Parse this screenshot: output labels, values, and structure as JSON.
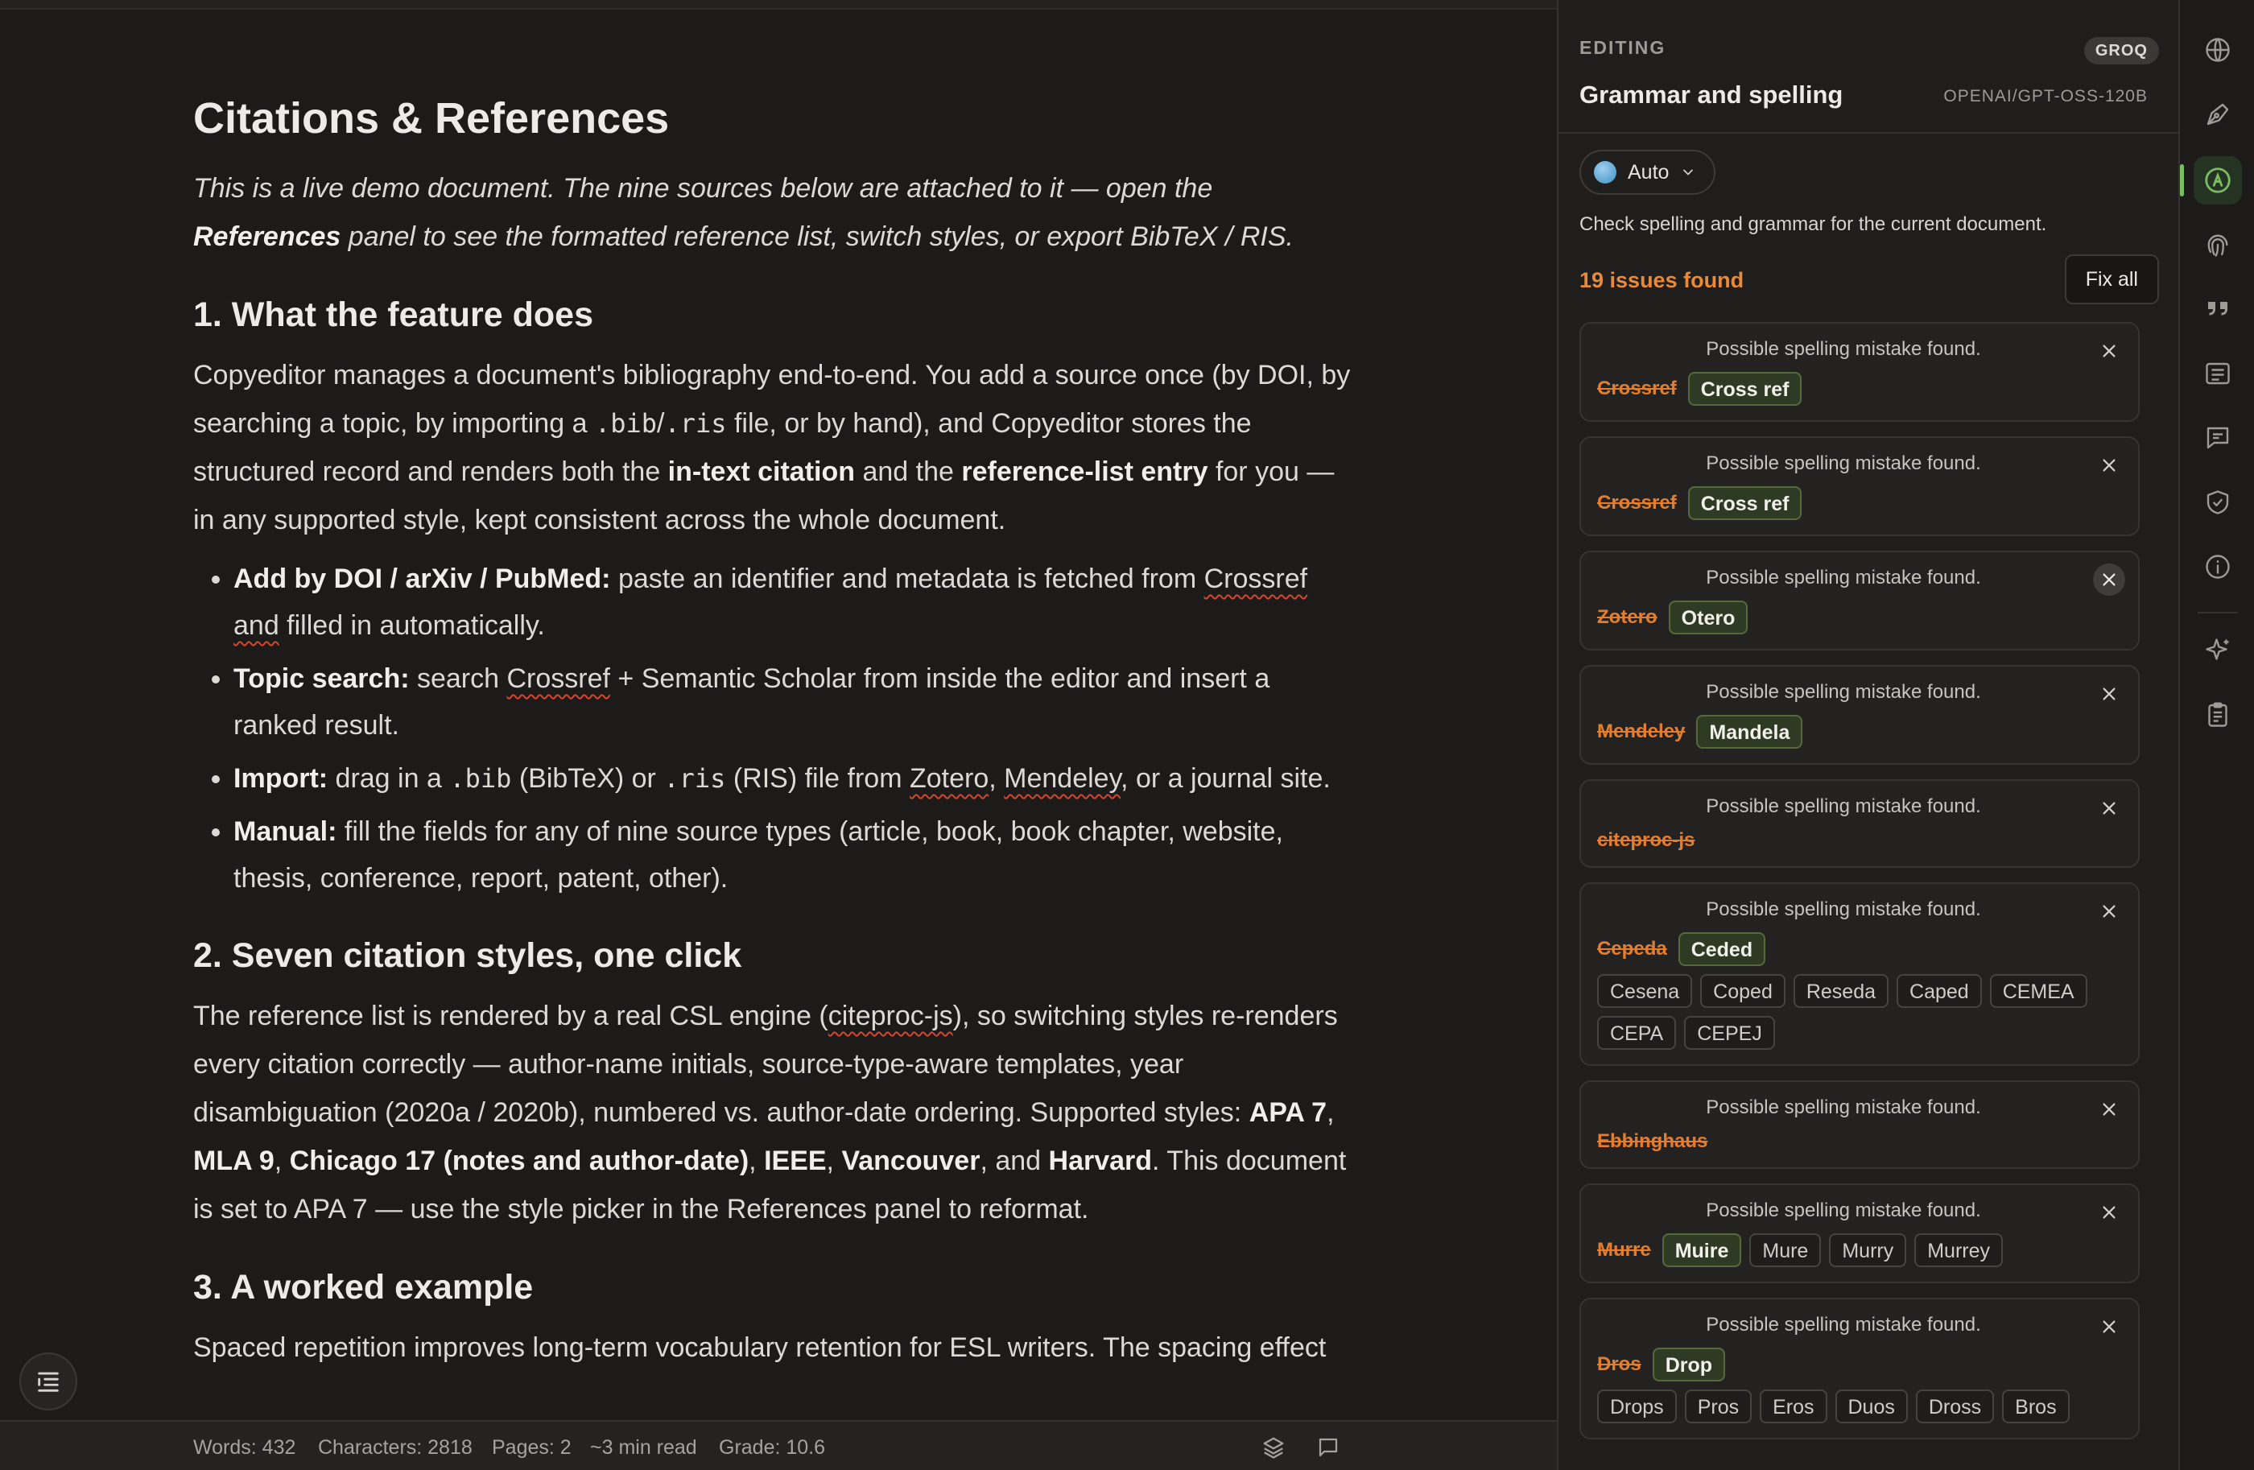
{
  "document": {
    "title": "Citations & References",
    "intro": {
      "a": "This is a live demo document. The nine sources below are attached to it — open the ",
      "b": "References",
      "c": " panel to see the formatted reference list, switch styles, or export BibTeX / RIS."
    },
    "s1": {
      "heading": "1. What the feature does",
      "p1": "Copyeditor manages a document's bibliography end-to-end. You add a source once (by DOI, by searching a topic, by importing a ",
      "code1": ".bib",
      "slash": "/",
      "code2": ".ris",
      "p2": " file, or by hand), and Copyeditor stores the structured record and renders both the ",
      "b1": "in-text citation",
      "p3": " and the ",
      "b2": "reference-list entry",
      "p4": " for you — in any supported style, kept consistent across the whole document.",
      "bullets": {
        "b1_label": "Add by DOI / arXiv / PubMed:",
        "b1_text": " paste an identifier and metadata is fetched from ",
        "b1_sq": "Crossref",
        "b1_sq2": "and",
        "b1_end": " filled in automatically.",
        "b2_label": "Topic search:",
        "b2_text": " search ",
        "b2_sq": "Crossref",
        "b2_end": " + Semantic Scholar from inside the editor and insert a ranked result.",
        "b3_label": "Import:",
        "b3_t1": " drag in a ",
        "b3_c1": ".bib",
        "b3_t2": " (BibTeX) or ",
        "b3_c2": ".ris",
        "b3_t3": " (RIS) file from ",
        "b3_sq1": "Zotero",
        "b3_t4": ", ",
        "b3_sq2": "Mendeley",
        "b3_end": ", or a journal site.",
        "b4_label": "Manual:",
        "b4_text": " fill the fields for any of nine source types (article, book, book chapter, website, thesis, conference, report, patent, other)."
      }
    },
    "s2": {
      "heading": "2. Seven citation styles, one click",
      "t1": "The reference list is rendered by a real CSL engine (",
      "sq": "citeproc-js",
      "t2": "), so switching styles re-renders every citation correctly — author-name initials, source-type-aware templates, year disambiguation (2020a / 2020b), numbered vs. author-date ordering. Supported styles: ",
      "st1": "APA 7",
      "c1": ", ",
      "st2": "MLA 9",
      "c2": ", ",
      "st3": "Chicago 17 (notes and author-date)",
      "c3": ", ",
      "st4": "IEEE",
      "c4": ", ",
      "st5": "Vancouver",
      "c5": ", and ",
      "st6": "Harvard",
      "t3": ". This document is set to APA 7 — use the style picker in the References panel to reformat."
    },
    "s3": {
      "heading": "3. A worked example",
      "p": "Spaced repetition improves long-term vocabulary retention for ESL writers. The spacing effect"
    }
  },
  "statusbar": {
    "words": "Words: 432",
    "characters": "Characters: 2818",
    "pages": "Pages: 2",
    "read": "~3 min read",
    "grade": "Grade: 10.6"
  },
  "panel": {
    "section": "EDITING",
    "provider": "GROQ",
    "title": "Grammar and spelling",
    "model": "OPENAI/GPT-OSS-120B",
    "language": "Auto",
    "description": "Check spelling and grammar for the current document.",
    "issue_count": "19 issues found",
    "fix_all": "Fix all",
    "issues": [
      {
        "message": "Possible spelling mistake found.",
        "wrong": "Crossref",
        "primary": "Cross ref",
        "alternatives": []
      },
      {
        "message": "Possible spelling mistake found.",
        "wrong": "Crossref",
        "primary": "Cross ref",
        "alternatives": []
      },
      {
        "message": "Possible spelling mistake found.",
        "wrong": "Zotero",
        "primary": "Otero",
        "alternatives": []
      },
      {
        "message": "Possible spelling mistake found.",
        "wrong": "Mendeley",
        "primary": "Mandela",
        "alternatives": []
      },
      {
        "message": "Possible spelling mistake found.",
        "wrong": "citeproc-js",
        "primary": "",
        "alternatives": []
      },
      {
        "message": "Possible spelling mistake found.",
        "wrong": "Cepeda",
        "primary": "Ceded",
        "alternatives": [
          "Cesena",
          "Coped",
          "Reseda",
          "Caped",
          "CEMEA",
          "CEPA",
          "CEPEJ"
        ]
      },
      {
        "message": "Possible spelling mistake found.",
        "wrong": "Ebbinghaus",
        "primary": "",
        "alternatives": []
      },
      {
        "message": "Possible spelling mistake found.",
        "wrong": "Murre",
        "primary": "Muire",
        "alternatives": [
          "Mure",
          "Murry",
          "Murrey"
        ]
      },
      {
        "message": "Possible spelling mistake found.",
        "wrong": "Dros",
        "primary": "Drop",
        "alternatives": [
          "Drops",
          "Pros",
          "Eros",
          "Duos",
          "Dross",
          "Bros"
        ]
      }
    ]
  },
  "colors": {
    "accent_orange": "#e78a3c",
    "accent_green": "#7dbb63",
    "error_squiggle": "#d9452c",
    "background": "#1c1b1a"
  },
  "rail_icons": [
    "globe-icon",
    "pen-nib-icon",
    "spellcheck-icon",
    "fingerprint-icon",
    "quote-icon",
    "references-icon",
    "comment-icon",
    "shield-check-icon",
    "info-icon",
    "sparkle-icon",
    "clipboard-icon"
  ]
}
